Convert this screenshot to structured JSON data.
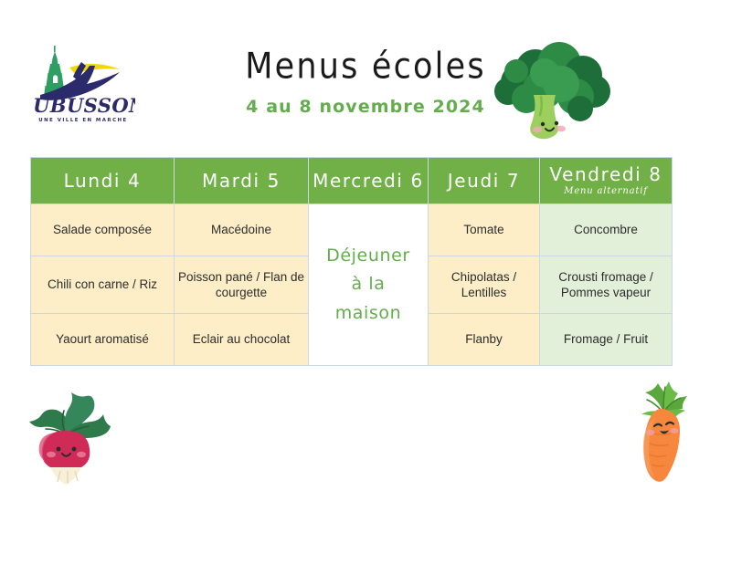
{
  "header": {
    "title": "Menus écoles",
    "subtitle": "4 au 8 novembre 2024",
    "logo": {
      "name": "AUBUSSON",
      "tagline": "UNE VILLE EN MARCHE",
      "colors": {
        "navy": "#2b2a6b",
        "yellow": "#f2d800",
        "green": "#2e9e62"
      }
    }
  },
  "decorations": {
    "broccoli": "broccoli-illustration",
    "radish": "radish-illustration",
    "carrot": "carrot-illustration"
  },
  "table": {
    "columns": [
      {
        "day": "Lundi 4",
        "note": ""
      },
      {
        "day": "Mardi 5",
        "note": ""
      },
      {
        "day": "Mercredi 6",
        "note": ""
      },
      {
        "day": "Jeudi 7",
        "note": ""
      },
      {
        "day": "Vendredi 8",
        "note": "Menu alternatif"
      }
    ],
    "rows": [
      {
        "lundi": "Salade composée",
        "mardi": "Macédoine",
        "jeudi": "Tomate",
        "vendredi": "Concombre"
      },
      {
        "lundi": "Chili con carne / Riz",
        "mardi": "Poisson pané / Flan de courgette",
        "jeudi": "Chipolatas / Lentilles",
        "vendredi": "Crousti fromage / Pommes vapeur"
      },
      {
        "lundi": "Yaourt aromatisé",
        "mardi": "Eclair au chocolat",
        "jeudi": "Flanby",
        "vendredi": "Fromage / Fruit"
      }
    ],
    "mercredi_merged": "Déjeuner à la maison",
    "mercredi_merged_lines": [
      "Déjeuner",
      "à la",
      "maison"
    ],
    "colors": {
      "header_green": "#70b046",
      "cell_cream": "#fdeec8",
      "cell_lightgreen": "#e2efd9",
      "accent_green": "#63ad4c",
      "border": "#c9d8e4"
    }
  }
}
